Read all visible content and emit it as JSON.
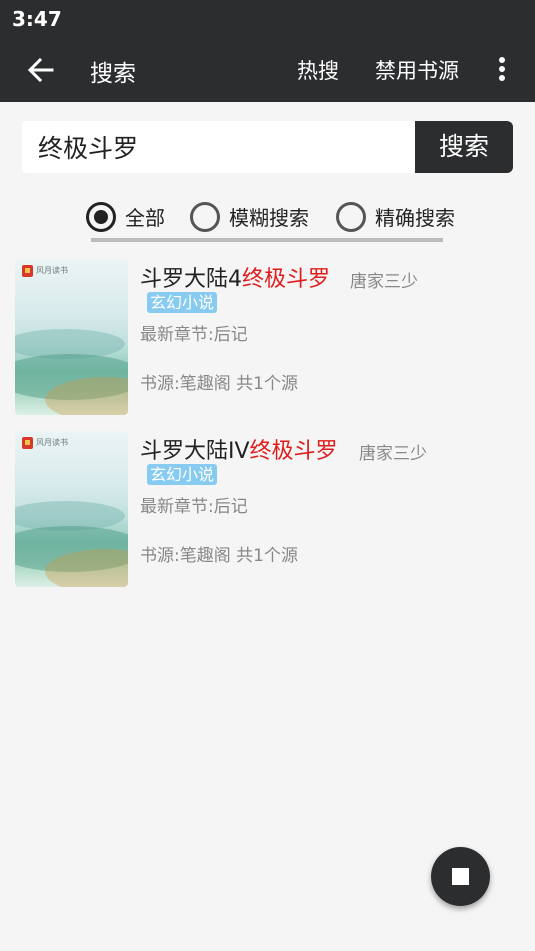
{
  "status_bar": {
    "time": "3:47"
  },
  "toolbar": {
    "title": "搜索",
    "actions": [
      "热搜",
      "禁用书源"
    ],
    "back_icon": "arrow-left-icon",
    "more_icon": "more-vert-icon"
  },
  "search": {
    "value": "终极斗罗",
    "button_label": "搜索"
  },
  "filters": {
    "options": [
      "全部",
      "模糊搜索",
      "精确搜索"
    ],
    "selected": "全部"
  },
  "results": [
    {
      "title_prefix": "斗罗大陆4",
      "title_keyword": "终极斗罗",
      "author": "唐家三少",
      "tag": "玄幻小说",
      "latest": "最新章节:后记",
      "source": "书源:笔趣阁 共1个源",
      "cover_brand": "风月读书"
    },
    {
      "title_prefix": "斗罗大陆IV",
      "title_keyword": "终极斗罗",
      "author": "唐家三少",
      "tag": "玄幻小说",
      "latest": "最新章节:后记",
      "source": "书源:笔趣阁 共1个源",
      "cover_brand": "风月读书"
    }
  ],
  "fab": {
    "icon": "stop-icon"
  },
  "colors": {
    "toolbar": "#2b2d2f",
    "keyword": "#e01c1c",
    "tag": "#87cbf1",
    "background": "#f5f5f5"
  }
}
